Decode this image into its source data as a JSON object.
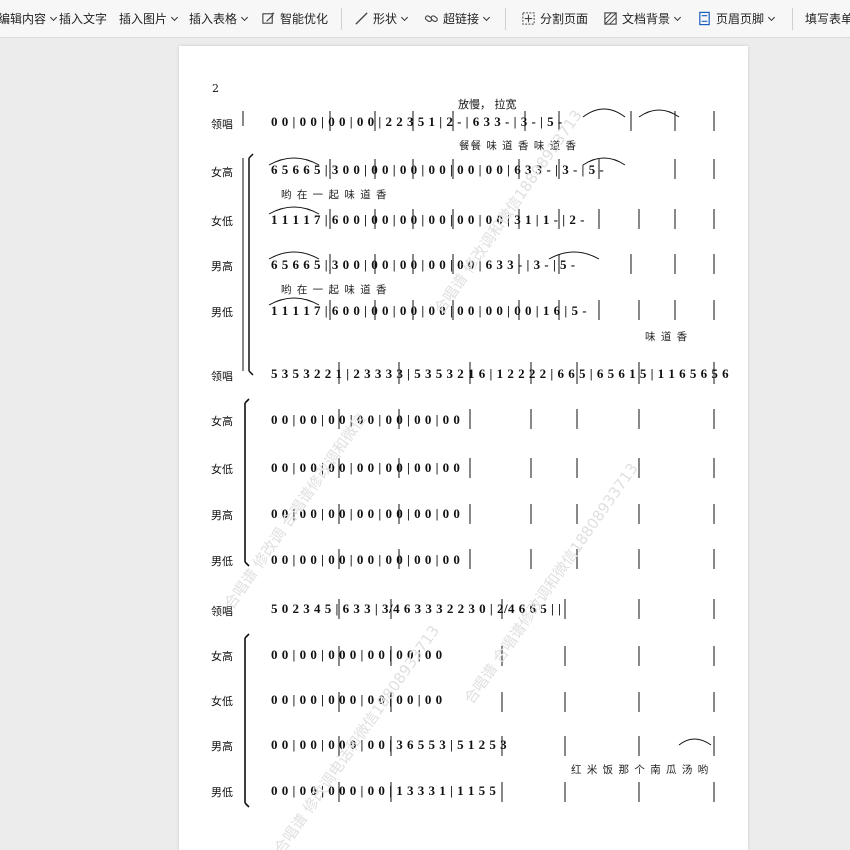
{
  "toolbar": {
    "items": [
      {
        "label": "编辑内容",
        "icon": "",
        "caret": true
      },
      {
        "label": "插入文字",
        "icon": "",
        "caret": false
      },
      {
        "label": "插入图片",
        "icon": "",
        "caret": true
      },
      {
        "label": "插入表格",
        "icon": "",
        "caret": true
      },
      {
        "label": "智能优化",
        "icon": "smart-optimize-icon",
        "caret": false
      },
      {
        "label": "形状",
        "icon": "line-shape-icon",
        "caret": true
      },
      {
        "label": "超链接",
        "icon": "link-icon",
        "caret": true
      },
      {
        "label": "分割页面",
        "icon": "split-page-icon",
        "caret": false
      },
      {
        "label": "文档背景",
        "icon": "background-icon",
        "caret": true
      },
      {
        "label": "页眉页脚",
        "icon": "header-footer-icon",
        "caret": true
      },
      {
        "label": "填写表单",
        "icon": "",
        "caret": false
      }
    ]
  },
  "page": {
    "page_number": "2",
    "tempo_marking": "放慢，  拉宽",
    "parts": [
      "领唱",
      "女高",
      "女低",
      "男高",
      "男低"
    ],
    "systems": [
      {
        "rows": [
          {
            "part": "领唱",
            "notes": "0   0   | 0  0 | 0 0 | 0 0 | 2 2 3 5  1 | 2 -  |  6 3  3 -  | 3 -  | 5 -"
          },
          {
            "part": "女高",
            "notes": "6 5  6 6 5 | 3 0 0 | 0 0 | 0 0 | 0    0  | 0 0 | 0 0 | 6 3  3 -  | 3 -  | 5 -"
          },
          {
            "part": "女低",
            "notes": "1 1  1 1 7 | 6 0 0 | 0 0 | 0 0 | 0    0  | 0 0 | 0 0 | 3  1  | 1 -  | 2 -"
          },
          {
            "part": "男高",
            "notes": "6 5  6 6 5 | 3 0 0 | 0 0 | 0 0 | 0    0  | 0 0 | 6 3  3 -  | 3 -  | 5 -"
          },
          {
            "part": "男低",
            "notes": "1 1  1 1 7 | 6 0 0 | 0 0 | 0 0 | 0    0  | 0 0 | 0 0 | 0 0 | 1 6  | 5 -"
          }
        ],
        "lyrics": [
          {
            "after": "领唱",
            "text": "餐餐 味 道 香      味  道                              香"
          },
          {
            "after": "女高",
            "text": "哟 在 一     起                                                          味  道                  香"
          },
          {
            "after": "男高",
            "text": "哟 在 一     起                                        味  道                              香"
          },
          {
            "after": "男低",
            "text": "味  道    香"
          }
        ]
      },
      {
        "rows": [
          {
            "part": "领唱",
            "notes": "5 3 5 3 2 2 1 | 2 3 3 3 3 | 5 3 5 3 2 1 6 | 1 2 2 2 2 | 6 6 5 | 6 5 6 1 5 | 1 1 6 5 6 5 6"
          },
          {
            "part": "女高",
            "notes": "0    0   | 0    0 | 0    0   | 0    0 | 0    0 | 0    0 | 0    0"
          },
          {
            "part": "女低",
            "notes": "0    0   | 0    0 | 0    0   | 0    0 | 0    0 | 0    0 | 0    0"
          },
          {
            "part": "男高",
            "notes": "0    0   | 0    0 | 0    0   | 0    0 | 0    0 | 0    0 | 0    0"
          },
          {
            "part": "男低",
            "notes": "0    0   | 0    0 | 0    0   | 0    0 | 0    0 | 0    0 | 0    0"
          }
        ],
        "lyrics": []
      },
      {
        "rows": [
          {
            "part": "领唱",
            "notes": "5 0  2 3 4 5 | 6   3 3 | 3/4 6 3 3 3 2 2 3 0 | 2/4 6 6 5 |                   |"
          },
          {
            "part": "女高",
            "notes": "0    0    | 0 0 | 0    0     0 | 0    0 | 0    0 | 0    0"
          },
          {
            "part": "女低",
            "notes": "0    0    | 0 0 | 0    0     0 | 0    0 | 0    0 | 0    0"
          },
          {
            "part": "男高",
            "notes": "0    0    | 0 0 | 0    0     0 | 0    0 | 3 6  5 5 3 | 5 1  2 5 3"
          },
          {
            "part": "男低",
            "notes": "0    0    | 0 0 | 0    0     0 | 0    0 | 1 3  3 3 1 | 1 1  5 5"
          }
        ],
        "lyrics": [
          {
            "after": "男高",
            "text": "红 米 饭 那 个   南 瓜 汤 哟"
          }
        ]
      }
    ],
    "watermarks": [
      "合唱谱   修改调   合唱谱修改调和微信",
      "合唱谱   修改调和微信18808933713",
      "合唱谱   合唱谱修改调和微信18808933713",
      "合唱谱   修改调电话和微信18808933713"
    ]
  }
}
